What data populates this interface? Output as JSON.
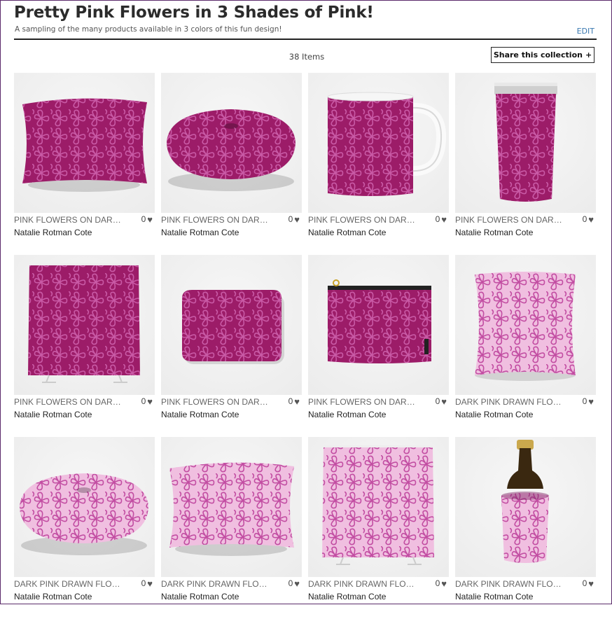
{
  "collection": {
    "title": "Pretty Pink Flowers in 3 Shades of Pink!",
    "subtitle": "A sampling of the many products available in 3 colors of this fun design!",
    "edit_label": "EDIT",
    "item_count": "38 Items",
    "share_label": "Share this collection",
    "share_icon": "+"
  },
  "colors": {
    "dark_fabric": "#9c1c68",
    "dark_petal": "#c95aa6",
    "light_fabric": "#f0bfe0",
    "light_petal": "#c24da2",
    "background": "#ececec"
  },
  "products": [
    {
      "title": "PINK FLOWERS ON DARK PINK",
      "likes": "0",
      "artist": "Natalie Rotman Cote",
      "product": "rectangular-pillow",
      "shade": "dark"
    },
    {
      "title": "PINK FLOWERS ON DARK PINK",
      "likes": "0",
      "artist": "Natalie Rotman Cote",
      "product": "floor-pillow",
      "shade": "dark"
    },
    {
      "title": "PINK FLOWERS ON DARK PINK",
      "likes": "0",
      "artist": "Natalie Rotman Cote",
      "product": "mug",
      "shade": "dark"
    },
    {
      "title": "PINK FLOWERS ON DARK PINK",
      "likes": "0",
      "artist": "Natalie Rotman Cote",
      "product": "travel-mug",
      "shade": "dark"
    },
    {
      "title": "PINK FLOWERS ON DARK PINK",
      "likes": "0",
      "artist": "Natalie Rotman Cote",
      "product": "shower-curtain",
      "shade": "dark"
    },
    {
      "title": "PINK FLOWERS ON DARK PINK",
      "likes": "0",
      "artist": "Natalie Rotman Cote",
      "product": "bath-mat",
      "shade": "dark"
    },
    {
      "title": "PINK FLOWERS ON DARK PINK",
      "likes": "0",
      "artist": "Natalie Rotman Cote",
      "product": "carry-all-pouch",
      "shade": "dark"
    },
    {
      "title": "DARK PINK DRAWN FLOWERS",
      "likes": "0",
      "artist": "Natalie Rotman Cote",
      "product": "throw-pillow",
      "shade": "light"
    },
    {
      "title": "DARK PINK DRAWN FLOWERS",
      "likes": "0",
      "artist": "Natalie Rotman Cote",
      "product": "floor-pillow",
      "shade": "light"
    },
    {
      "title": "DARK PINK DRAWN FLOWERS",
      "likes": "0",
      "artist": "Natalie Rotman Cote",
      "product": "rectangular-pillow",
      "shade": "light"
    },
    {
      "title": "DARK PINK DRAWN FLOWERS",
      "likes": "0",
      "artist": "Natalie Rotman Cote",
      "product": "shower-curtain",
      "shade": "light"
    },
    {
      "title": "DARK PINK DRAWN FLOWERS",
      "likes": "0",
      "artist": "Natalie Rotman Cote",
      "product": "wine-chiller",
      "shade": "light"
    }
  ]
}
